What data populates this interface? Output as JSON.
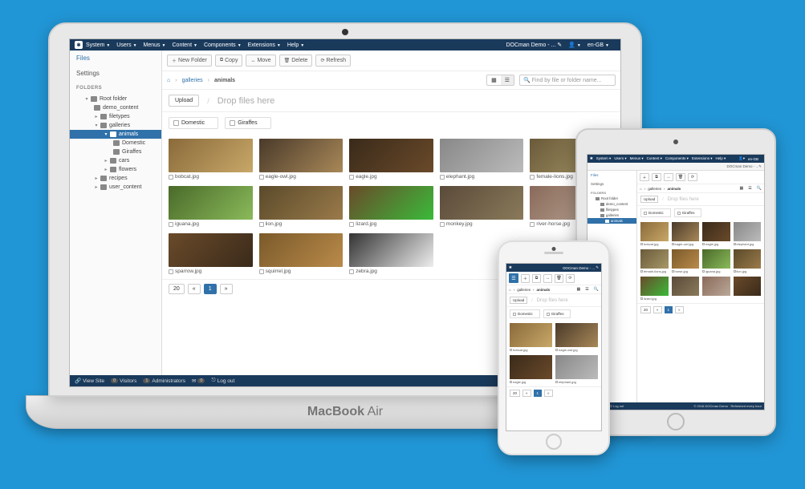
{
  "menu": {
    "items": [
      "System",
      "Users",
      "Menus",
      "Content",
      "Components",
      "Extensions",
      "Help"
    ],
    "site": "DOCman Demo - ...",
    "siteEdit": "✎",
    "lang": "en-GB"
  },
  "sidebar": {
    "tabs": [
      "Files",
      "Settings"
    ],
    "foldersHeader": "FOLDERS",
    "tree": [
      "Root folder",
      "demo_content",
      "filetypes",
      "galleries",
      "animals",
      "Domestic",
      "Giraffes",
      "cars",
      "flowers",
      "recipes",
      "user_content"
    ]
  },
  "toolbar": {
    "new": "New Folder",
    "copy": "Copy",
    "move": "Move",
    "delete": "Delete",
    "refresh": "Refresh"
  },
  "breadcrumb": {
    "home": "⌂",
    "items": [
      "galleries",
      "animals"
    ]
  },
  "search": {
    "placeholder": "Find by file or folder name..."
  },
  "upload": {
    "btn": "Upload",
    "drop": "Drop files here"
  },
  "groups": [
    "Domestic",
    "Giraffes"
  ],
  "files": [
    "bobcat.jpg",
    "eagle-owl.jpg",
    "eagle.jpg",
    "elephant.jpg",
    "female-lions.jpg",
    "iguana.jpg",
    "lion.jpg",
    "lizard.jpg",
    "monkey.jpg",
    "river-horse.jpg",
    "sparrow.jpg",
    "squirrel.jpg",
    "zebra.jpg"
  ],
  "pager": {
    "size": "20",
    "prev": "«",
    "page": "1",
    "next": "»"
  },
  "status": {
    "view": "View Site",
    "visitors": "Visitors",
    "visitorsN": "0",
    "admins": "Administrators",
    "adminsN": "1",
    "msgN": "0",
    "logout": "Log out"
  },
  "tablet": {
    "files": [
      "bobcat.jpg",
      "eagle-owl.jpg",
      "eagle.jpg",
      "elephant.jpg",
      "female-lions.jpg",
      "horse.jpg",
      "iguana.jpg",
      "lion.jpg",
      "lizard.jpg"
    ],
    "footer": "© 2016 DOCman Demo · Refreshed every hour"
  },
  "phone": {
    "files": [
      "bobcat.jpg",
      "eagle-owl.jpg",
      "eagle.jpg",
      "elephant.jpg"
    ]
  }
}
